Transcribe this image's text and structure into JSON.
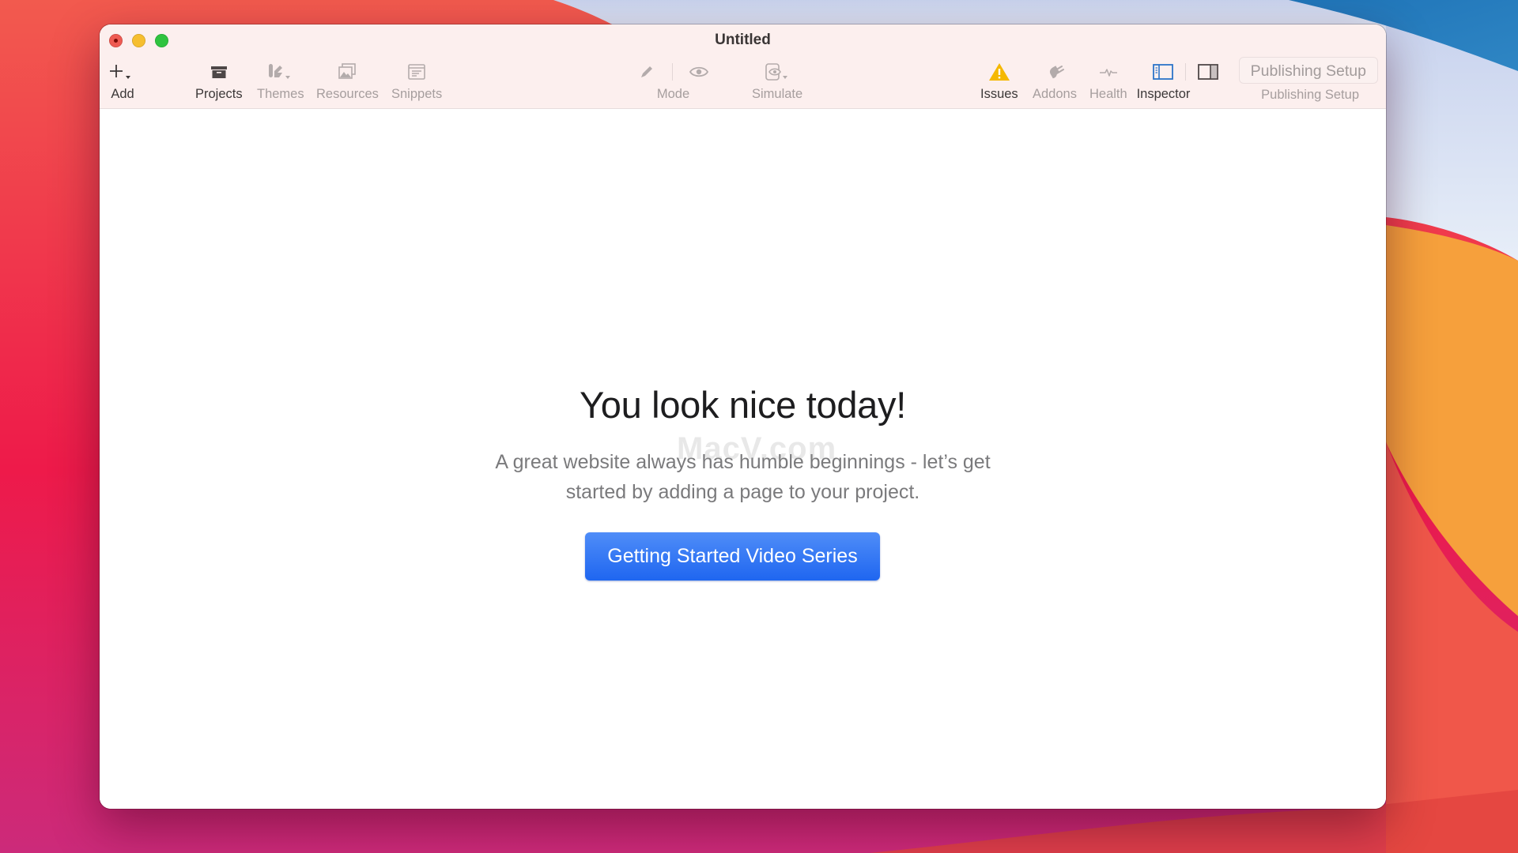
{
  "window": {
    "title": "Untitled"
  },
  "toolbar": {
    "left": [
      {
        "id": "add",
        "label": "Add",
        "icon": "plus-icon",
        "dropdown": true,
        "enabled": true
      },
      {
        "id": "projects",
        "label": "Projects",
        "icon": "archive-box-icon",
        "dropdown": false,
        "enabled": true
      },
      {
        "id": "themes",
        "label": "Themes",
        "icon": "theme-brush-icon",
        "dropdown": true,
        "enabled": false
      },
      {
        "id": "resources",
        "label": "Resources",
        "icon": "photos-stack-icon",
        "dropdown": false,
        "enabled": false
      },
      {
        "id": "snippets",
        "label": "Snippets",
        "icon": "snippet-window-icon",
        "dropdown": false,
        "enabled": false
      }
    ],
    "center": [
      {
        "id": "mode",
        "label": "Mode",
        "icons": [
          "pencil-icon",
          "eye-icon"
        ],
        "enabled": false
      },
      {
        "id": "simulate",
        "label": "Simulate",
        "icon": "device-eye-icon",
        "dropdown": true,
        "enabled": false
      }
    ],
    "right": [
      {
        "id": "issues",
        "label": "Issues",
        "icon": "warning-triangle-icon",
        "enabled": true
      },
      {
        "id": "addons",
        "label": "Addons",
        "icon": "plug-icon",
        "enabled": false
      },
      {
        "id": "health",
        "label": "Health",
        "icon": "pulse-icon",
        "enabled": false
      },
      {
        "id": "inspector",
        "label": "Inspector",
        "icons": [
          "left-sidebar-icon",
          "right-sidebar-icon"
        ],
        "enabled": true
      }
    ],
    "publishing": {
      "button_label": "Publishing Setup",
      "label": "Publishing Setup"
    }
  },
  "content": {
    "title": "You look nice today!",
    "subtitle_lines": [
      "A great website always has humble beginnings - let’s get",
      "started by adding a page to your project."
    ],
    "cta_label": "Getting Started Video Series",
    "watermark": "MacV.com"
  },
  "colors": {
    "accent": "#2f74f5",
    "warning": "#f5b800",
    "inspector_active": "#2b74c9",
    "titlebar": "#fcefee"
  }
}
